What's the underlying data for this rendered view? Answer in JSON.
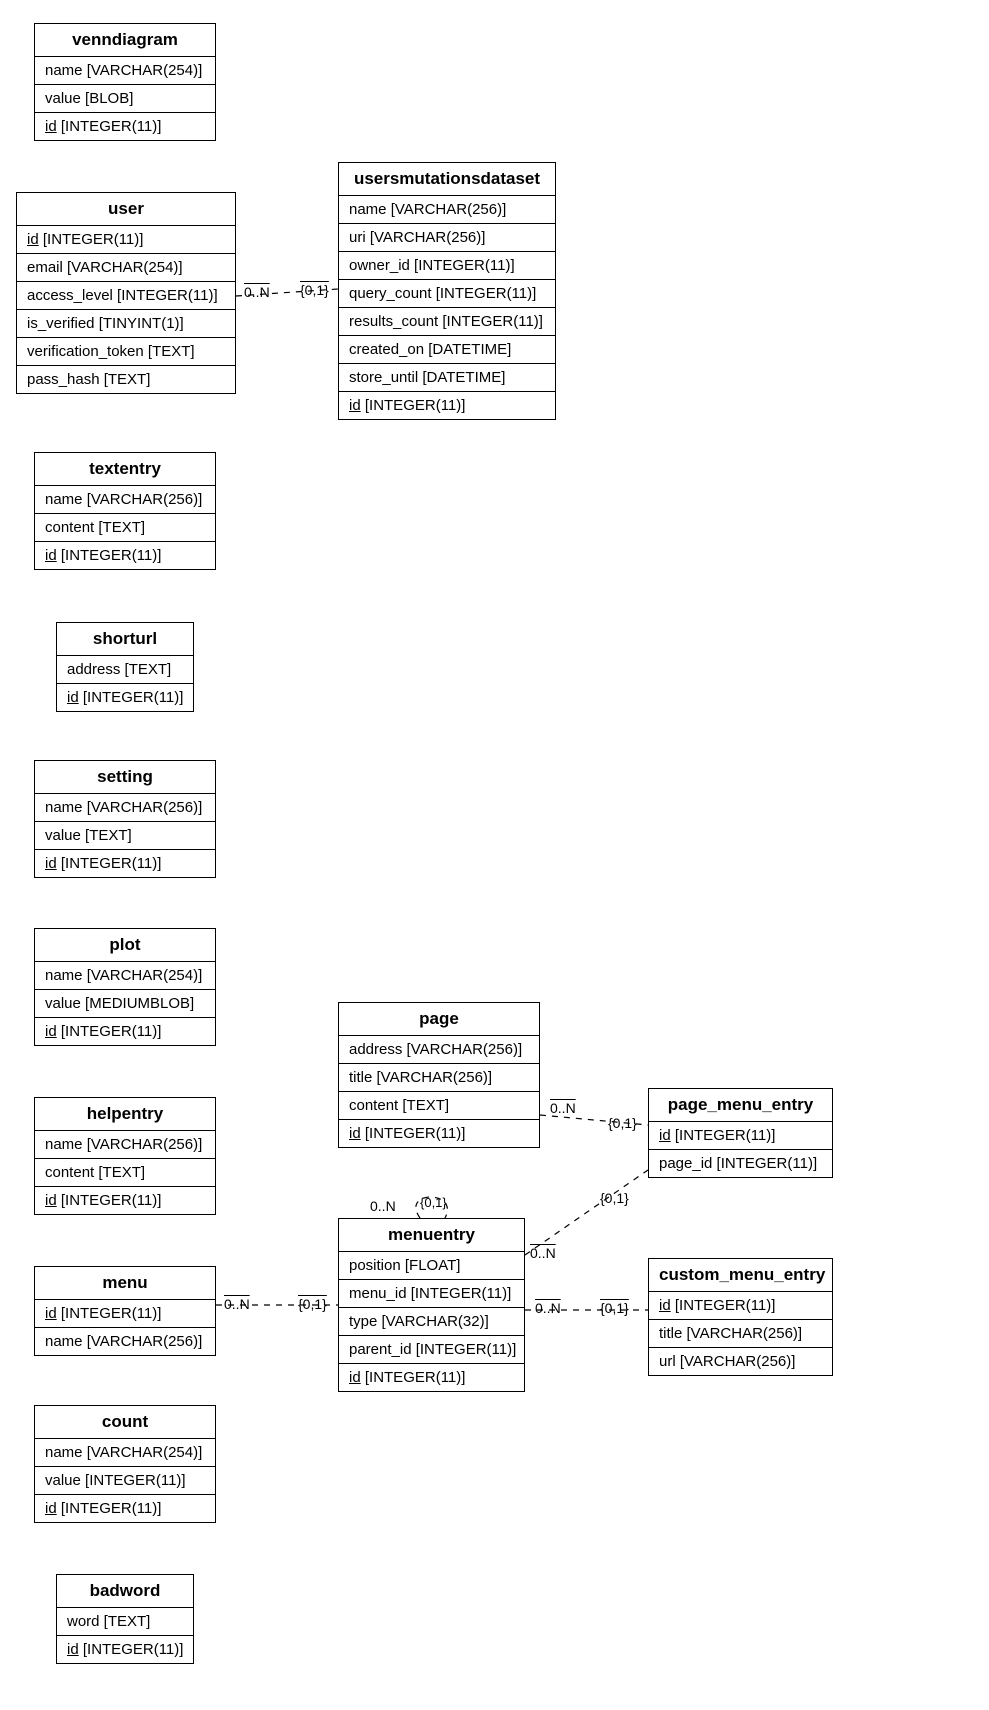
{
  "entities": {
    "venndiagram": {
      "title": "venndiagram",
      "rows": [
        {
          "text": "name [VARCHAR(254)]",
          "pk": false
        },
        {
          "text": "value [BLOB]",
          "pk": false
        },
        {
          "text": "id",
          "suffix": " [INTEGER(11)]",
          "pk": true
        }
      ]
    },
    "user": {
      "title": "user",
      "rows": [
        {
          "text": "id",
          "suffix": " [INTEGER(11)]",
          "pk": true
        },
        {
          "text": "email [VARCHAR(254)]",
          "pk": false
        },
        {
          "text": "access_level [INTEGER(11)]",
          "pk": false
        },
        {
          "text": "is_verified [TINYINT(1)]",
          "pk": false
        },
        {
          "text": "verification_token [TEXT]",
          "pk": false
        },
        {
          "text": "pass_hash [TEXT]",
          "pk": false
        }
      ]
    },
    "usersmutationsdataset": {
      "title": "usersmutationsdataset",
      "rows": [
        {
          "text": "name [VARCHAR(256)]",
          "pk": false
        },
        {
          "text": "uri [VARCHAR(256)]",
          "pk": false
        },
        {
          "text": "owner_id [INTEGER(11)]",
          "pk": false
        },
        {
          "text": "query_count [INTEGER(11)]",
          "pk": false
        },
        {
          "text": "results_count [INTEGER(11)]",
          "pk": false
        },
        {
          "text": "created_on [DATETIME]",
          "pk": false
        },
        {
          "text": "store_until [DATETIME]",
          "pk": false
        },
        {
          "text": "id",
          "suffix": " [INTEGER(11)]",
          "pk": true
        }
      ]
    },
    "textentry": {
      "title": "textentry",
      "rows": [
        {
          "text": "name [VARCHAR(256)]",
          "pk": false
        },
        {
          "text": "content [TEXT]",
          "pk": false
        },
        {
          "text": "id",
          "suffix": " [INTEGER(11)]",
          "pk": true
        }
      ]
    },
    "shorturl": {
      "title": "shorturl",
      "rows": [
        {
          "text": "address [TEXT]",
          "pk": false
        },
        {
          "text": "id",
          "suffix": " [INTEGER(11)]",
          "pk": true
        }
      ]
    },
    "setting": {
      "title": "setting",
      "rows": [
        {
          "text": "name [VARCHAR(256)]",
          "pk": false
        },
        {
          "text": "value [TEXT]",
          "pk": false
        },
        {
          "text": "id",
          "suffix": " [INTEGER(11)]",
          "pk": true
        }
      ]
    },
    "plot": {
      "title": "plot",
      "rows": [
        {
          "text": "name [VARCHAR(254)]",
          "pk": false
        },
        {
          "text": "value [MEDIUMBLOB]",
          "pk": false
        },
        {
          "text": "id",
          "suffix": " [INTEGER(11)]",
          "pk": true
        }
      ]
    },
    "helpentry": {
      "title": "helpentry",
      "rows": [
        {
          "text": "name [VARCHAR(256)]",
          "pk": false
        },
        {
          "text": "content [TEXT]",
          "pk": false
        },
        {
          "text": "id",
          "suffix": " [INTEGER(11)]",
          "pk": true
        }
      ]
    },
    "menu": {
      "title": "menu",
      "rows": [
        {
          "text": "id",
          "suffix": " [INTEGER(11)]",
          "pk": true
        },
        {
          "text": "name [VARCHAR(256)]",
          "pk": false
        }
      ]
    },
    "page": {
      "title": "page",
      "rows": [
        {
          "text": "address [VARCHAR(256)]",
          "pk": false
        },
        {
          "text": "title [VARCHAR(256)]",
          "pk": false
        },
        {
          "text": "content [TEXT]",
          "pk": false
        },
        {
          "text": "id",
          "suffix": " [INTEGER(11)]",
          "pk": true
        }
      ]
    },
    "menuentry": {
      "title": "menuentry",
      "rows": [
        {
          "text": "position [FLOAT]",
          "pk": false
        },
        {
          "text": "menu_id [INTEGER(11)]",
          "pk": false
        },
        {
          "text": "type [VARCHAR(32)]",
          "pk": false
        },
        {
          "text": "parent_id [INTEGER(11)]",
          "pk": false
        },
        {
          "text": "id",
          "suffix": " [INTEGER(11)]",
          "pk": true
        }
      ]
    },
    "page_menu_entry": {
      "title": "page_menu_entry",
      "rows": [
        {
          "text": "id",
          "suffix": " [INTEGER(11)]",
          "pk": true
        },
        {
          "text": "page_id [INTEGER(11)]",
          "pk": false
        }
      ]
    },
    "custom_menu_entry": {
      "title": "custom_menu_entry",
      "rows": [
        {
          "text": "id",
          "suffix": " [INTEGER(11)]",
          "pk": true
        },
        {
          "text": "title [VARCHAR(256)]",
          "pk": false
        },
        {
          "text": "url [VARCHAR(256)]",
          "pk": false
        }
      ]
    },
    "count": {
      "title": "count",
      "rows": [
        {
          "text": "name [VARCHAR(254)]",
          "pk": false
        },
        {
          "text": "value [INTEGER(11)]",
          "pk": false
        },
        {
          "text": "id",
          "suffix": " [INTEGER(11)]",
          "pk": true
        }
      ]
    },
    "badword": {
      "title": "badword",
      "rows": [
        {
          "text": "word [TEXT]",
          "pk": false
        },
        {
          "text": "id",
          "suffix": " [INTEGER(11)]",
          "pk": true
        }
      ]
    }
  },
  "labels": {
    "rel1_left": "0..N",
    "rel1_right": "{0,1}",
    "rel2_left": "0..N",
    "rel2_right": "{0,1}",
    "rel3_left": "0..N",
    "rel3_right": "{0,1}",
    "rel4_left": "0..N",
    "rel4_right": "{0,1}",
    "rel5_left": "0..N",
    "rel5_right": "{0,1}",
    "rel6_left": "0..N",
    "rel6_right": "{0,1}"
  }
}
